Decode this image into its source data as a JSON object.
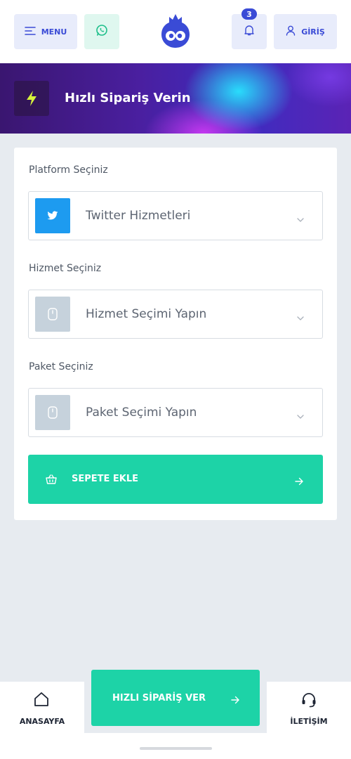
{
  "header": {
    "menu_label": "MENU",
    "login_label": "GİRİŞ",
    "notification_count": "3"
  },
  "banner": {
    "title": "Hızlı Sipariş Verin"
  },
  "form": {
    "platform": {
      "label": "Platform Seçiniz",
      "value": "Twitter Hizmetleri"
    },
    "service": {
      "label": "Hizmet Seçiniz",
      "placeholder": "Hizmet Seçimi Yapın"
    },
    "package": {
      "label": "Paket Seçiniz",
      "placeholder": "Paket Seçimi Yapın"
    },
    "add_to_cart": "SEPETE EKLE"
  },
  "bottom_nav": {
    "home": "ANASAYFA",
    "quick_order": "HIZLI SİPARİŞ VER",
    "contact": "İLETİŞİM"
  },
  "colors": {
    "accent": "#3a4bd6",
    "green": "#1dd3a7",
    "twitter": "#1d9bf0"
  }
}
